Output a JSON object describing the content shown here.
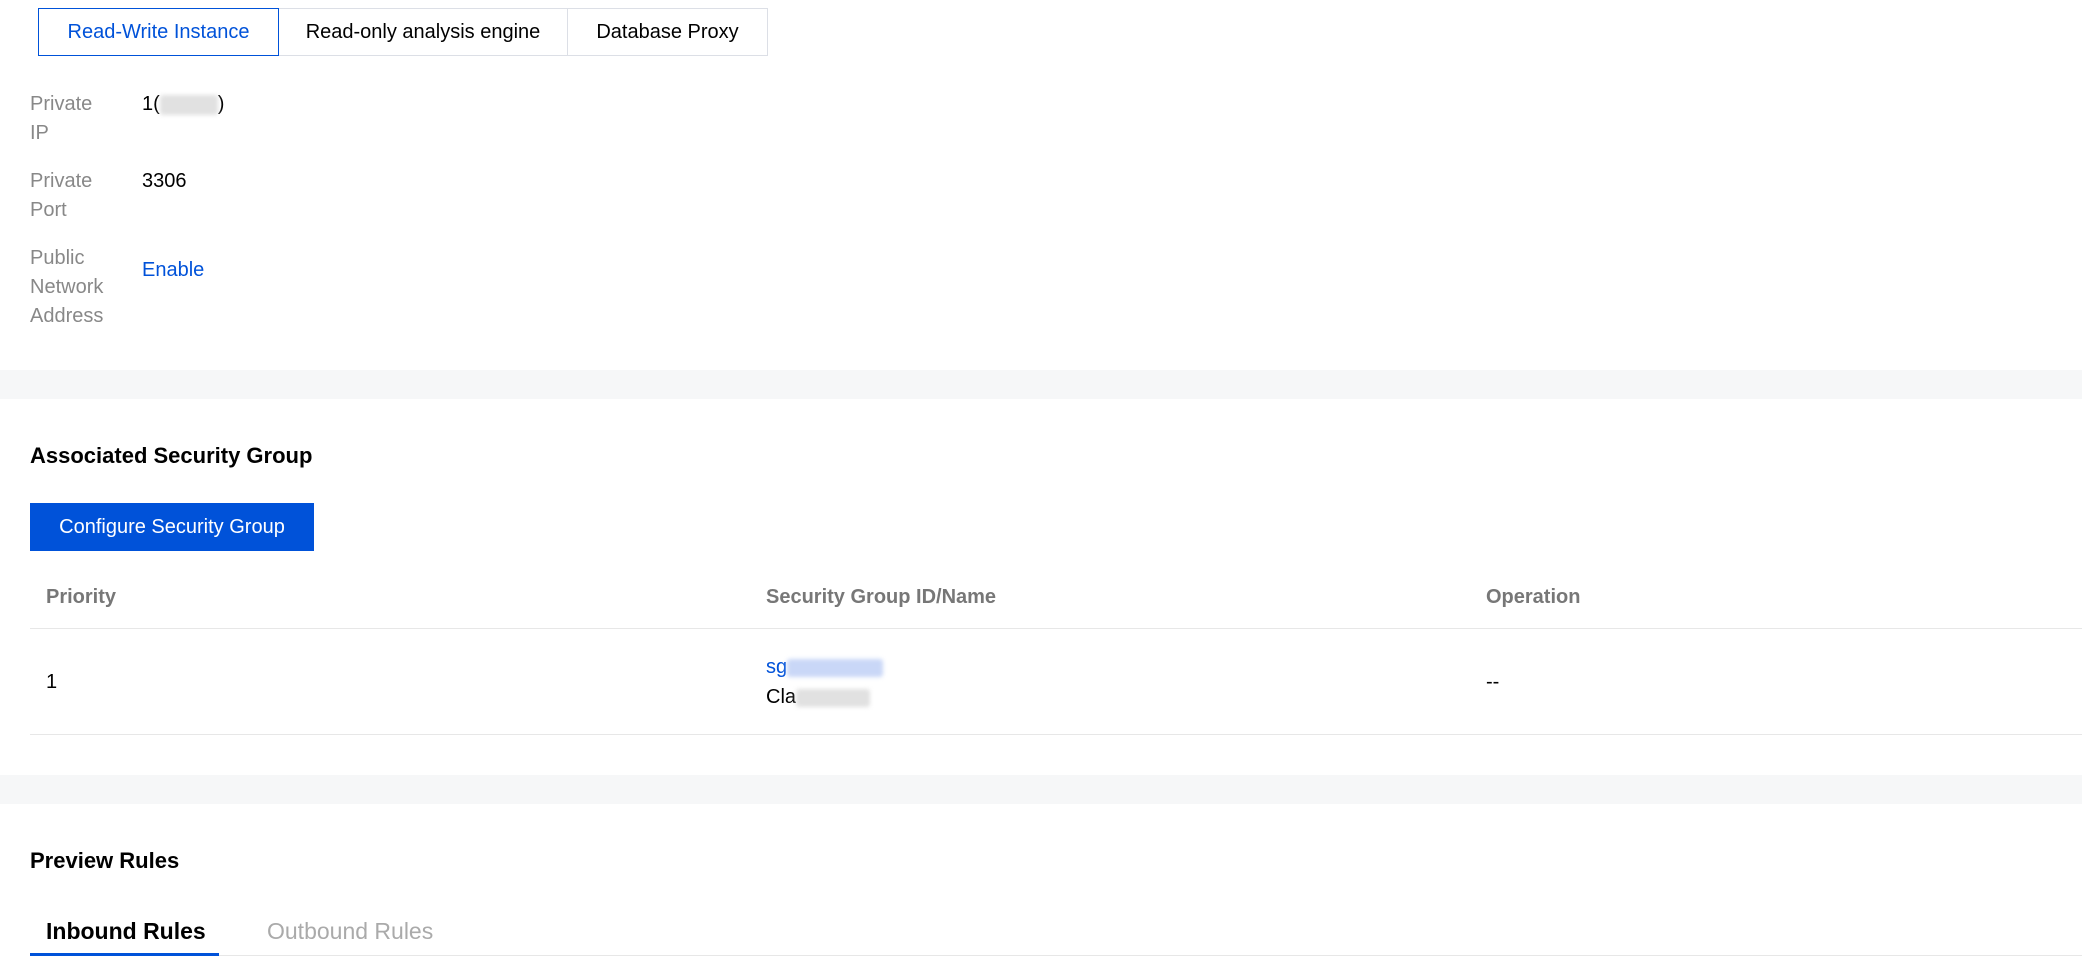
{
  "segment_tabs": [
    {
      "label": "Read-Write Instance",
      "active": true
    },
    {
      "label": "Read-only analysis engine",
      "active": false
    },
    {
      "label": "Database Proxy",
      "active": false
    }
  ],
  "network": {
    "private_ip": {
      "label_line1": "Private",
      "label_line2": "IP",
      "value_prefix": "1(",
      "value_suffix": ")"
    },
    "private_port": {
      "label_line1": "Private",
      "label_line2": "Port",
      "value": "3306"
    },
    "public_address": {
      "label_line1": "Public",
      "label_line2": "Network",
      "label_line3": "Address",
      "action": "Enable"
    }
  },
  "security_group": {
    "title": "Associated Security Group",
    "configure_button": "Configure Security Group",
    "columns": [
      "Priority",
      "Security Group ID/Name",
      "Operation"
    ],
    "rows": [
      {
        "priority": "1",
        "id_prefix": "sg",
        "name_prefix": "Cla",
        "operation": "--"
      }
    ]
  },
  "preview_rules": {
    "title": "Preview Rules",
    "tabs": [
      {
        "label": "Inbound Rules",
        "active": true
      },
      {
        "label": "Outbound Rules",
        "active": false
      }
    ]
  },
  "colors": {
    "accent": "#0052d9",
    "muted_label": "#888888",
    "section_gap": "#f6f7f8"
  }
}
